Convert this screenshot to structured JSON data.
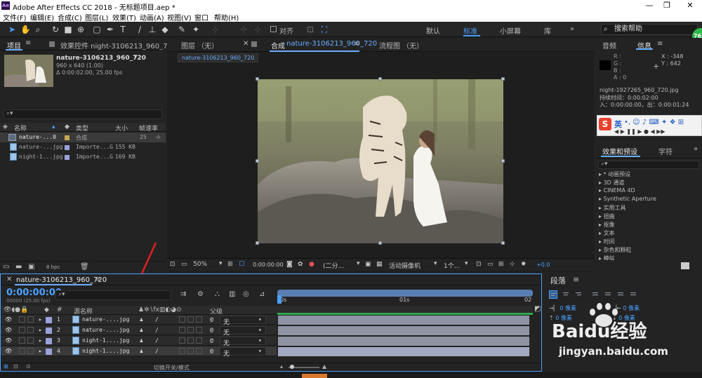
{
  "window": {
    "app_icon": "Ae",
    "title": "Adobe After Effects CC 2018 - 无标题项目.aep *",
    "controls": [
      "—",
      "❐",
      "✕"
    ]
  },
  "menu": [
    "文件(F)",
    "编辑(E)",
    "合成(C)",
    "图层(L)",
    "效果(T)",
    "动画(A)",
    "视图(V)",
    "窗口",
    "帮助(H)"
  ],
  "toolbar": {
    "align_label": "对齐",
    "workspaces": [
      "默认",
      "标准",
      "小屏幕",
      "库"
    ],
    "active_workspace": "标准",
    "help_search": "搜索帮助",
    "badge": "76"
  },
  "project_panel": {
    "tab_project": "项目",
    "tab_effects": "效果控件 night-3106213_960_72",
    "selected_name": "nature-3106213_960_720",
    "selected_info": [
      "960 x 640 (1.00)",
      "Δ 0:00:02:00, 25.00 fps"
    ],
    "columns": [
      "名称",
      "类型",
      "大小",
      "帧速率"
    ],
    "items": [
      {
        "name": "nature-...0",
        "type": "合成",
        "size": "",
        "fps": "25",
        "color": "#c9a94f",
        "kind": "comp"
      },
      {
        "name": "nature-...jpg",
        "type": "Importe...G",
        "size": "155 KB",
        "fps": "",
        "color": "#9aa2d9",
        "kind": "file"
      },
      {
        "name": "night-1...jpg",
        "type": "Importe...G",
        "size": "169 KB",
        "fps": "",
        "color": "#9aa2d9",
        "kind": "file"
      }
    ],
    "bpc": "8 bpc"
  },
  "viewer": {
    "tab_layer": "图层 （无）",
    "tab_comp_prefix": "合成",
    "tab_comp_name": "nature-3106213_960_720",
    "tab_flow": "流程图 （无）",
    "sub_tab": "nature-3106213_960_720",
    "zoom": "50%",
    "time": "0:00:00:00",
    "resolution": "(二分...",
    "camera": "活动摄像机",
    "views": "1个...",
    "exposure": "+0.0"
  },
  "info_panel": {
    "tab_audio": "音频",
    "tab_info": "信息",
    "rgba_labels": [
      "R :",
      "G :",
      "B :",
      "A : 0"
    ],
    "x_readout": "X : -348",
    "y_readout": "Y : 642",
    "file_name": "night-1927265_960_720.jpg",
    "duration": "持续时间：0:00:02:00",
    "in_out": "入：0:00:00:00，出：0:00:01:24"
  },
  "ime_bar": {
    "label": "英"
  },
  "effects_panel": {
    "tab_effects": "效果和预设",
    "tab_char": "字符",
    "items": [
      "* 动画预设",
      "3D 通道",
      "CINEMA 4D",
      "Synthetic Aperture",
      "实用工具",
      "扭曲",
      "抠像",
      "文本",
      "时间",
      "杂色和颗粒",
      "模拟"
    ]
  },
  "paragraph_panel": {
    "title": "段落",
    "indent_rows": [
      "0 像素",
      "0 像素",
      "0 像素",
      "0 像素"
    ],
    "baidu_text": "Baidu经验",
    "baidu_url": "jingyan.baidu.com"
  },
  "timeline": {
    "comp_name": "nature-3106213_960_720",
    "timecode": "0:00:00:00",
    "frame_info": "00000 (25.00 fps)",
    "ruler": [
      "0s",
      "01s",
      "02"
    ],
    "col_source": "源名称",
    "col_parent": "父级",
    "layers": [
      {
        "num": "1",
        "name": "nature-....jpg",
        "parent": "无"
      },
      {
        "num": "2",
        "name": "nature-....jpg",
        "parent": "无"
      },
      {
        "num": "3",
        "name": "night-1....jpg",
        "parent": "无"
      },
      {
        "num": "4",
        "name": "night-1....jpg",
        "parent": "无"
      }
    ],
    "toggle_label": "切换开关/模式"
  },
  "colors": {
    "accent": "#4aa0ff",
    "panel_bg": "#232323",
    "layer_bar": "#8e94a4",
    "arrow": "#e02020"
  }
}
